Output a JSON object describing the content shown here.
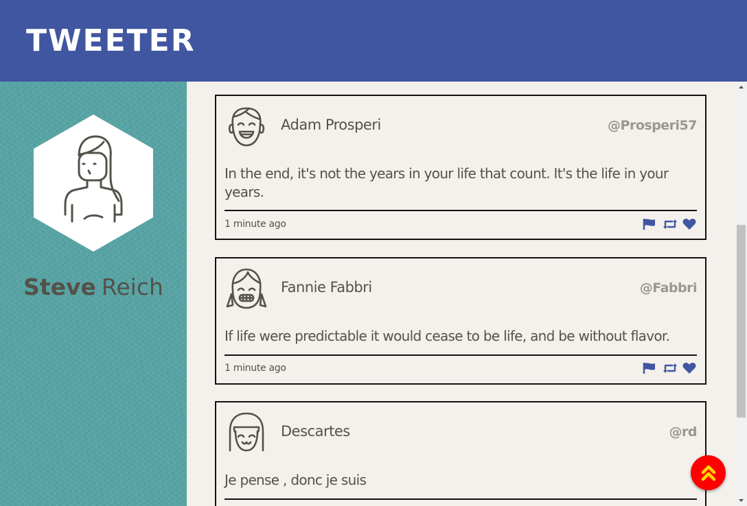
{
  "header": {
    "brand": "TWEETER"
  },
  "profile": {
    "first_name": "Steve",
    "last_name": "Reich",
    "avatar_icon": "user-avatar-icon"
  },
  "tweets": [
    {
      "author": "Adam Prosperi",
      "handle": "@Prosperi57",
      "text": "In the end, it's not the years in your life that count. It's the life in your years.",
      "time": "1 minute ago",
      "avatar_icon": "smiling-boy-icon"
    },
    {
      "author": "Fannie Fabbri",
      "handle": "@Fabbri",
      "text": "If life were predictable it would cease to be life, and be without flavor.",
      "time": "1 minute ago",
      "avatar_icon": "grinning-girl-icon"
    },
    {
      "author": "Descartes",
      "handle": "@rd",
      "text": "Je pense , donc je suis",
      "time": "",
      "avatar_icon": "happy-girl-icon"
    }
  ],
  "actions": {
    "flag": "flag-icon",
    "retweet": "retweet-icon",
    "like": "heart-icon"
  },
  "colors": {
    "header": "#4056a1",
    "sidebar": "#57a3a4",
    "background": "#f4f1ec",
    "text": "#545149",
    "handle": "#9a9792",
    "action_icons": "#4056a1",
    "to_top_button": "#ff0000",
    "to_top_arrow": "#ffd700"
  }
}
